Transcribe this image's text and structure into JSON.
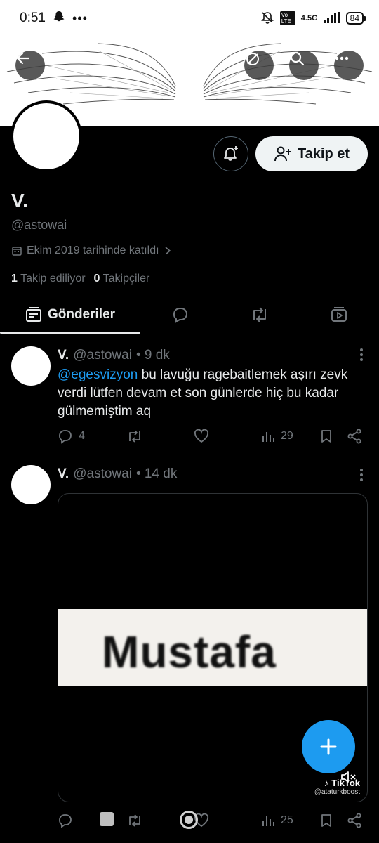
{
  "status_bar": {
    "time": "0:51",
    "network": "4.5G",
    "volte": "Vo LTE",
    "battery": "84"
  },
  "profile": {
    "name": "V.",
    "handle": "@astowai",
    "joined": "Ekim 2019 tarihinde katıldı",
    "following_count": "1",
    "following_label": "Takip ediliyor",
    "followers_count": "0",
    "followers_label": "Takipçiler",
    "follow_label": "Takip et"
  },
  "tabs": {
    "posts_label": "Gönderiler"
  },
  "tweets": [
    {
      "name": "V.",
      "handle": "@astowai",
      "time": "• 9 dk",
      "mention": "@egesvizyon",
      "text": " bu lavuğu ragebaitlemek aşırı zevk verdi lütfen devam et son günlerde hiç bu kadar gülmemiştim aq",
      "replies": "4",
      "views": "29"
    },
    {
      "name": "V.",
      "handle": "@astowai",
      "time": "• 14 dk",
      "media_text": "Mustafa",
      "tiktok_brand": "TikTok",
      "tiktok_user": "@ataturkboost",
      "views": "25"
    }
  ],
  "colors": {
    "accent": "#1d9bf0",
    "background": "#000000",
    "muted": "#71767b"
  }
}
